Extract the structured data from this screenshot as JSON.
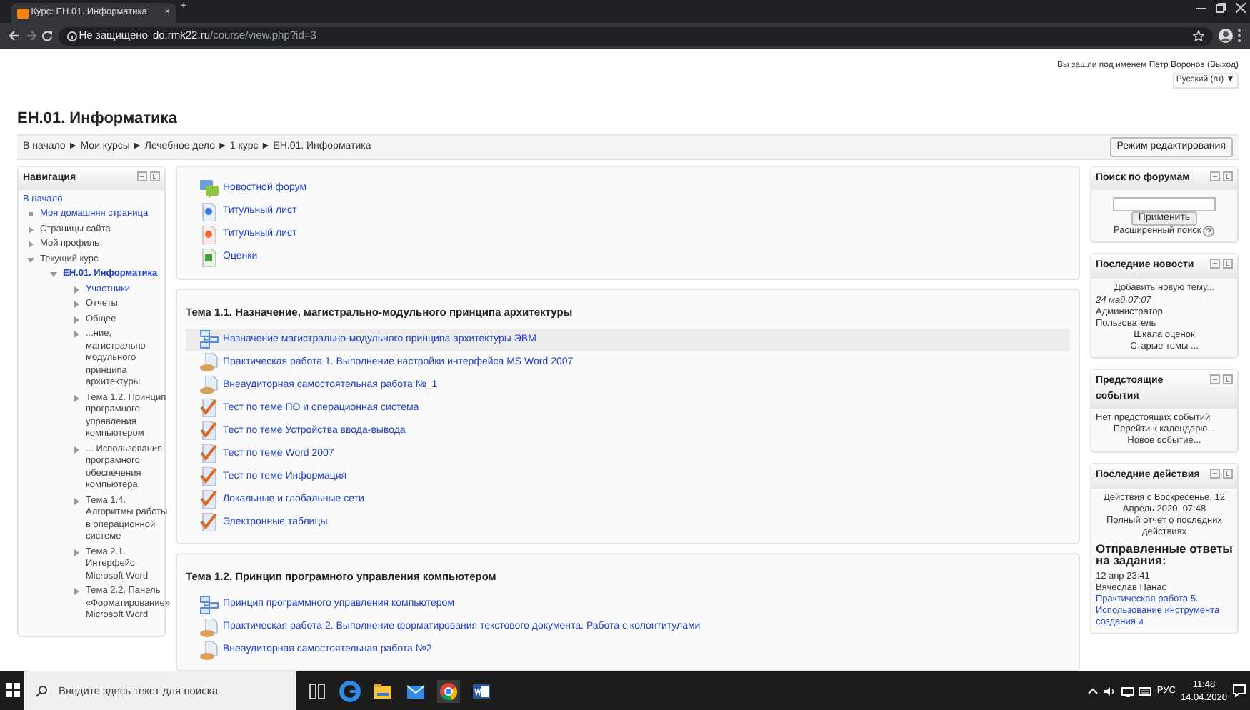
{
  "browser": {
    "tab_title": "Курс: ЕН.01. Информатика",
    "tab_close": "×",
    "new_tab": "+",
    "security": "Не защищено",
    "host": "do.rmk22.ru",
    "path": "/course/view.php?id=3"
  },
  "header": {
    "title": "ЕН.01. Информатика",
    "login_prefix": "Вы зашли под именем",
    "user": "Петр Воронов",
    "logout": "(Выход)",
    "language": "Русский (ru) ▼"
  },
  "breadcrumbs": [
    "В начало",
    "Мои курсы",
    "Лечебное дело",
    "1 курс",
    "ЕН.01. Информатика"
  ],
  "breadcrumb_separator": "►",
  "edit_button": "Режим редактирования",
  "navigation": {
    "title": "Навигация",
    "home": "В начало",
    "items": [
      {
        "label": "Моя домашняя страница",
        "kind": "leaf",
        "linked": true
      },
      {
        "label": "Страницы сайта",
        "kind": "branch",
        "expanded": false,
        "linked": false
      },
      {
        "label": "Мой профиль",
        "kind": "branch",
        "expanded": false,
        "linked": false
      },
      {
        "label": "Текущий курс",
        "kind": "branch",
        "expanded": true,
        "linked": false,
        "children": [
          {
            "label": "ЕН.01. Информатика",
            "kind": "branch",
            "expanded": true,
            "linked": true,
            "current": true,
            "children": [
              {
                "label": "Участники",
                "kind": "branch",
                "expanded": false,
                "linked": true
              },
              {
                "label": "Отчеты",
                "kind": "branch",
                "expanded": false,
                "linked": false
              },
              {
                "label": "Общее",
                "kind": "branch",
                "expanded": false,
                "linked": false
              },
              {
                "label": "...ние, магистрально-модульного принципа архитектуры",
                "kind": "branch",
                "expanded": false,
                "linked": false
              },
              {
                "label": "Тема 1.2. Принцип програмного управления компьютером",
                "kind": "branch",
                "expanded": false,
                "linked": false
              },
              {
                "label": "... Использования програмного обеспечения компьютера",
                "kind": "branch",
                "expanded": false,
                "linked": false
              },
              {
                "label": "Тема 1.4. Алгоритмы работы в операционной системе",
                "kind": "branch",
                "expanded": false,
                "linked": false
              },
              {
                "label": "Тема 2.1. Интерфейс Microsoft Word",
                "kind": "branch",
                "expanded": false,
                "linked": false
              },
              {
                "label": "Тема 2.2. Панель «Форматирование» Microsoft Word",
                "kind": "branch",
                "expanded": false,
                "linked": false
              }
            ]
          }
        ]
      }
    ]
  },
  "sections": [
    {
      "activities": [
        {
          "kind": "forum",
          "label": "Новостной форум",
          "highlighted": false
        },
        {
          "kind": "doc",
          "label": "Титульный лист",
          "highlighted": false
        },
        {
          "kind": "pdf",
          "label": "Титульный лист",
          "highlighted": false
        },
        {
          "kind": "sheet",
          "label": "Оценки",
          "highlighted": false
        }
      ]
    },
    {
      "title": "Тема 1.1. Назначение, магистрально-модульного принципа архитектуры",
      "activities": [
        {
          "kind": "folder",
          "label": "Назначение магистрально-модульного принципа архитектуры ЭВМ",
          "highlighted": true
        },
        {
          "kind": "assign",
          "label": "Практическая работа 1. Выполнение настройки интерфейса MS Word 2007",
          "highlighted": false
        },
        {
          "kind": "assign",
          "label": "Внеаудиторная самостоятельная работа №_1",
          "highlighted": false
        },
        {
          "kind": "quiz",
          "label": "Тест по теме ПО и операционная система",
          "highlighted": false
        },
        {
          "kind": "quiz",
          "label": "Тест по теме Устройства ввода-вывода",
          "highlighted": false
        },
        {
          "kind": "quiz",
          "label": "Тест по теме Word 2007",
          "highlighted": false
        },
        {
          "kind": "quiz",
          "label": "Тест по теме Информация",
          "highlighted": false
        },
        {
          "kind": "quiz",
          "label": "Локальные и глобальные сети",
          "highlighted": false
        },
        {
          "kind": "quiz",
          "label": "Электронные таблицы",
          "highlighted": false
        }
      ]
    },
    {
      "title": "Тема 1.2. Принцип програмного управления компьютером",
      "activities": [
        {
          "kind": "folder",
          "label": "Принцип программного управления компьютером",
          "highlighted": false
        },
        {
          "kind": "assign",
          "label": "Практическая работа 2. Выполнение форматирования текстового документа. Работа с колонтитулами",
          "highlighted": false
        },
        {
          "kind": "assign",
          "label": "Внеаудиторная самостоятельная работа №2",
          "highlighted": false
        }
      ]
    }
  ],
  "blocks": [
    {
      "title": "Поиск по форумам",
      "content": [
        {
          "kind": "field"
        },
        {
          "kind": "button",
          "text": "Применить"
        },
        {
          "kind": "help-link",
          "text": "Расширенный поиск"
        }
      ]
    },
    {
      "title": "Последние новости",
      "content": [
        {
          "kind": "link",
          "text": "Добавить новую тему..."
        },
        {
          "kind": "date",
          "text": "24 май 07:07"
        },
        {
          "kind": "text",
          "text": "Администратор"
        },
        {
          "kind": "text",
          "text": "Пользователь"
        },
        {
          "kind": "link",
          "text": "Шкала оценок"
        },
        {
          "kind": "link",
          "text": "Старые темы ..."
        }
      ]
    },
    {
      "title": "Предстоящие события",
      "content": [
        {
          "kind": "text",
          "text": "Нет предстоящих событий"
        },
        {
          "kind": "link",
          "text": "Перейти к календарю..."
        },
        {
          "kind": "link",
          "text": "Новое событие..."
        }
      ]
    },
    {
      "title": "Последние действия",
      "content": [
        {
          "kind": "center-text",
          "text": "Действия с Воскресенье, 12 Апрель 2020, 07:48"
        },
        {
          "kind": "link",
          "text": "Полный отчет о последних действиях"
        },
        {
          "kind": "heading",
          "text": "Отправленные ответы на задания:"
        },
        {
          "kind": "text",
          "text": "12 апр 23:41"
        },
        {
          "kind": "text",
          "text": "Вячеслав Панас"
        },
        {
          "kind": "left-link",
          "text": "Практическая работа 5. Использование инструмента создания и"
        }
      ]
    }
  ],
  "taskbar": {
    "search_placeholder": "Введите здесь текст для поиска",
    "language": "РУС",
    "time": "11:48",
    "date": "14.04.2020"
  }
}
